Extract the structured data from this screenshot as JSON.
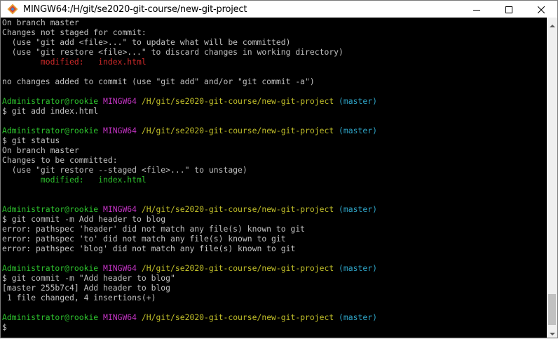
{
  "window": {
    "title": "MINGW64:/H/git/se2020-git-course/new-git-project",
    "app_icon": "git-bash-icon",
    "minimize_icon": "minimize-icon",
    "maximize_icon": "maximize-icon",
    "close_icon": "close-icon"
  },
  "colors": {
    "background": "#000000",
    "text": "#c0c0c0",
    "green": "#2dc22d",
    "magenta": "#c133c1",
    "yellow": "#c1bf29",
    "cyan": "#2fa6c9",
    "red": "#d12a2a"
  },
  "terminal": {
    "lines": [
      [
        {
          "t": "On branch master",
          "c": "grey"
        }
      ],
      [
        {
          "t": "Changes not staged for commit:",
          "c": "grey"
        }
      ],
      [
        {
          "t": "  (use \"git add <file>...\" to update what will be committed)",
          "c": "grey"
        }
      ],
      [
        {
          "t": "  (use \"git restore <file>...\" to discard changes in working directory)",
          "c": "grey"
        }
      ],
      [
        {
          "t": "        modified:   index.html",
          "c": "red"
        }
      ],
      [
        {
          "t": "",
          "c": "grey"
        }
      ],
      [
        {
          "t": "no changes added to commit (use \"git add\" and/or \"git commit -a\")",
          "c": "grey"
        }
      ],
      [
        {
          "t": "",
          "c": "grey"
        }
      ],
      [
        {
          "t": "Administrator@rookie ",
          "c": "green"
        },
        {
          "t": "MINGW64 ",
          "c": "magenta"
        },
        {
          "t": "/H/git/se2020-git-course/new-git-project",
          "c": "yellow"
        },
        {
          "t": " (master)",
          "c": "cyan"
        }
      ],
      [
        {
          "t": "$ git add index.html",
          "c": "grey"
        }
      ],
      [
        {
          "t": "",
          "c": "grey"
        }
      ],
      [
        {
          "t": "Administrator@rookie ",
          "c": "green"
        },
        {
          "t": "MINGW64 ",
          "c": "magenta"
        },
        {
          "t": "/H/git/se2020-git-course/new-git-project",
          "c": "yellow"
        },
        {
          "t": " (master)",
          "c": "cyan"
        }
      ],
      [
        {
          "t": "$ git status",
          "c": "grey"
        }
      ],
      [
        {
          "t": "On branch master",
          "c": "grey"
        }
      ],
      [
        {
          "t": "Changes to be committed:",
          "c": "grey"
        }
      ],
      [
        {
          "t": "  (use \"git restore --staged <file>...\" to unstage)",
          "c": "grey"
        }
      ],
      [
        {
          "t": "        modified:   index.html",
          "c": "green"
        }
      ],
      [
        {
          "t": "",
          "c": "grey"
        }
      ],
      [
        {
          "t": "",
          "c": "grey"
        }
      ],
      [
        {
          "t": "Administrator@rookie ",
          "c": "green"
        },
        {
          "t": "MINGW64 ",
          "c": "magenta"
        },
        {
          "t": "/H/git/se2020-git-course/new-git-project",
          "c": "yellow"
        },
        {
          "t": " (master)",
          "c": "cyan"
        }
      ],
      [
        {
          "t": "$ git commit -m Add header to blog",
          "c": "grey"
        }
      ],
      [
        {
          "t": "error: pathspec 'header' did not match any file(s) known to git",
          "c": "grey"
        }
      ],
      [
        {
          "t": "error: pathspec 'to' did not match any file(s) known to git",
          "c": "grey"
        }
      ],
      [
        {
          "t": "error: pathspec 'blog' did not match any file(s) known to git",
          "c": "grey"
        }
      ],
      [
        {
          "t": "",
          "c": "grey"
        }
      ],
      [
        {
          "t": "Administrator@rookie ",
          "c": "green"
        },
        {
          "t": "MINGW64 ",
          "c": "magenta"
        },
        {
          "t": "/H/git/se2020-git-course/new-git-project",
          "c": "yellow"
        },
        {
          "t": " (master)",
          "c": "cyan"
        }
      ],
      [
        {
          "t": "$ git commit -m \"Add header to blog\"",
          "c": "grey"
        }
      ],
      [
        {
          "t": "[master 255b7c4] Add header to blog",
          "c": "grey"
        }
      ],
      [
        {
          "t": " 1 file changed, 4 insertions(+)",
          "c": "grey"
        }
      ],
      [
        {
          "t": "",
          "c": "grey"
        }
      ],
      [
        {
          "t": "Administrator@rookie ",
          "c": "green"
        },
        {
          "t": "MINGW64 ",
          "c": "magenta"
        },
        {
          "t": "/H/git/se2020-git-course/new-git-project",
          "c": "yellow"
        },
        {
          "t": " (master)",
          "c": "cyan"
        }
      ],
      [
        {
          "t": "$",
          "c": "grey"
        }
      ]
    ]
  },
  "scrollbar": {
    "up_icon": "scroll-up-arrow-icon",
    "down_icon": "scroll-down-arrow-icon",
    "position": 1.0
  }
}
